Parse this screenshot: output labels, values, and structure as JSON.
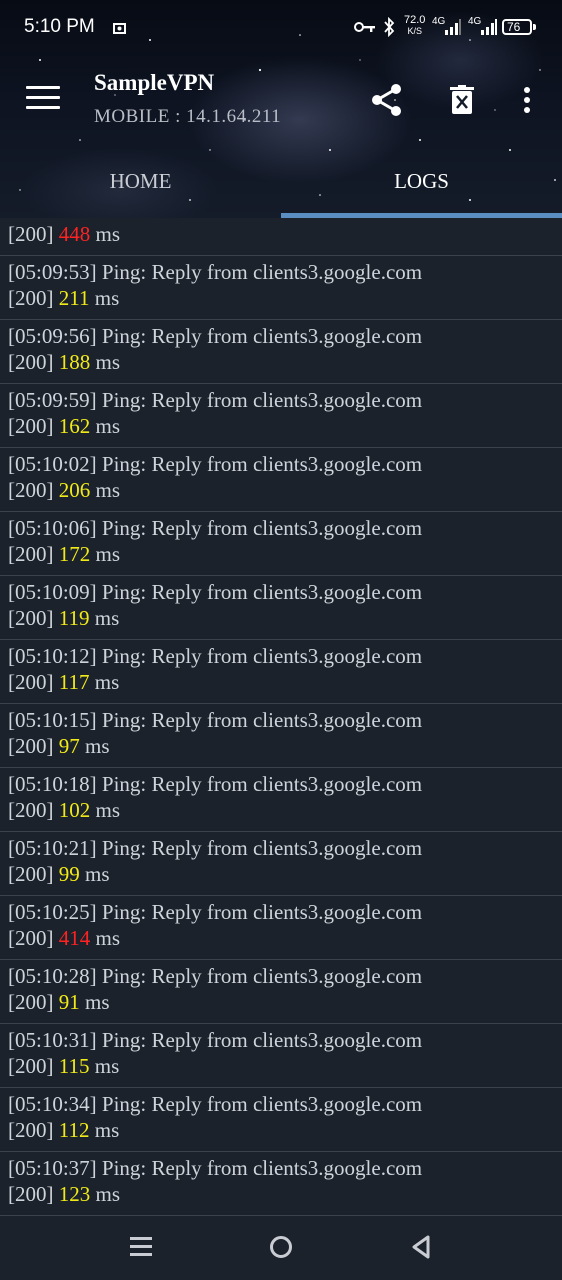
{
  "status_bar": {
    "time": "5:10 PM",
    "speed_value": "72.0",
    "speed_unit": "K/S",
    "network1": "4G",
    "network2": "4G",
    "battery": "76",
    "icons": [
      "key-icon",
      "bluetooth-icon",
      "signal-icon",
      "battery-icon"
    ]
  },
  "app": {
    "title": "SampleVPN",
    "subtitle": "MOBILE : 14.1.64.211"
  },
  "toolbar": {
    "icons": [
      "menu-icon",
      "share-icon",
      "delete-icon",
      "more-icon"
    ]
  },
  "tabs": [
    {
      "label": "HOME",
      "active": false
    },
    {
      "label": "LOGS",
      "active": true
    }
  ],
  "logs": {
    "partial_first": {
      "status": "[200]",
      "ms": "448",
      "unit": "ms",
      "color": "#ff2222"
    },
    "entries": [
      {
        "time": "[05:09:53] Ping: Reply from clients3.google.com",
        "status": "[200]",
        "ms": "211",
        "unit": "ms",
        "color": "#f1ea18"
      },
      {
        "time": "[05:09:56] Ping: Reply from clients3.google.com",
        "status": "[200]",
        "ms": "188",
        "unit": "ms",
        "color": "#f1ea18"
      },
      {
        "time": "[05:09:59] Ping: Reply from clients3.google.com",
        "status": "[200]",
        "ms": "162",
        "unit": "ms",
        "color": "#f1ea18"
      },
      {
        "time": "[05:10:02] Ping: Reply from clients3.google.com",
        "status": "[200]",
        "ms": "206",
        "unit": "ms",
        "color": "#f1ea18"
      },
      {
        "time": "[05:10:06] Ping: Reply from clients3.google.com",
        "status": "[200]",
        "ms": "172",
        "unit": "ms",
        "color": "#f1ea18"
      },
      {
        "time": "[05:10:09] Ping: Reply from clients3.google.com",
        "status": "[200]",
        "ms": "119",
        "unit": "ms",
        "color": "#f1ea18"
      },
      {
        "time": "[05:10:12] Ping: Reply from clients3.google.com",
        "status": "[200]",
        "ms": "117",
        "unit": "ms",
        "color": "#f1ea18"
      },
      {
        "time": "[05:10:15] Ping: Reply from clients3.google.com",
        "status": "[200]",
        "ms": "97",
        "unit": "ms",
        "color": "#f1ea18"
      },
      {
        "time": "[05:10:18] Ping: Reply from clients3.google.com",
        "status": "[200]",
        "ms": "102",
        "unit": "ms",
        "color": "#f1ea18"
      },
      {
        "time": "[05:10:21] Ping: Reply from clients3.google.com",
        "status": "[200]",
        "ms": "99",
        "unit": "ms",
        "color": "#f1ea18"
      },
      {
        "time": "[05:10:25] Ping: Reply from clients3.google.com",
        "status": "[200]",
        "ms": "414",
        "unit": "ms",
        "color": "#ff2222"
      },
      {
        "time": "[05:10:28] Ping: Reply from clients3.google.com",
        "status": "[200]",
        "ms": "91",
        "unit": "ms",
        "color": "#f1ea18"
      },
      {
        "time": "[05:10:31] Ping: Reply from clients3.google.com",
        "status": "[200]",
        "ms": "115",
        "unit": "ms",
        "color": "#f1ea18"
      },
      {
        "time": "[05:10:34] Ping: Reply from clients3.google.com",
        "status": "[200]",
        "ms": "112",
        "unit": "ms",
        "color": "#f1ea18"
      },
      {
        "time": "[05:10:37] Ping: Reply from clients3.google.com",
        "status": "[200]",
        "ms": "123",
        "unit": "ms",
        "color": "#f1ea18"
      }
    ]
  },
  "nav_bar": {
    "icons": [
      "recent-apps-icon",
      "home-icon",
      "back-icon"
    ]
  },
  "colors": {
    "accent": "#5b8fc4",
    "background": "#1b222b",
    "latency_ok": "#f1ea18",
    "latency_high": "#ff2222"
  }
}
